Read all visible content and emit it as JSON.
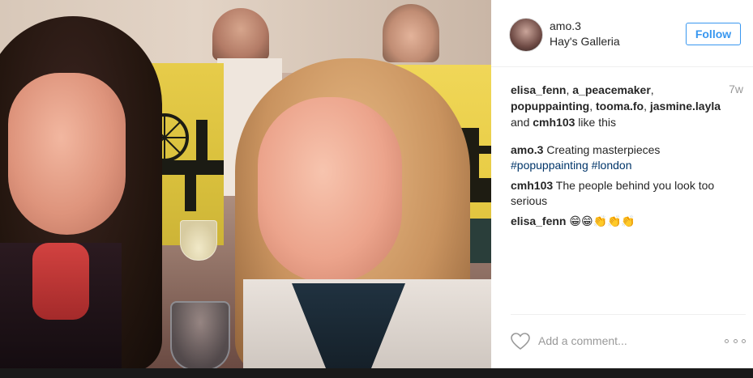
{
  "post": {
    "username": "amo.3",
    "location": "Hay's Galleria",
    "follow_label": "Follow",
    "time_ago": "7w"
  },
  "likes": {
    "users": [
      "elisa_fenn",
      "a_peacemaker",
      "popuppainting",
      "tooma.fo",
      "jasmine.layla",
      "cmh103"
    ],
    "connector": "and",
    "suffix": "like this"
  },
  "comments": [
    {
      "user": "amo.3",
      "text": "Creating masterpieces",
      "tags": [
        "#popuppainting",
        "#london"
      ]
    },
    {
      "user": "cmh103",
      "text": "The people behind you look too serious",
      "tags": []
    },
    {
      "user": "elisa_fenn",
      "text": "😁😁👏👏👏",
      "tags": []
    }
  ],
  "comment_box": {
    "placeholder": "Add a comment..."
  },
  "icons": {
    "like": "heart-icon",
    "options": "more-options-icon"
  },
  "colors": {
    "accent": "#3897f0",
    "text": "#262626",
    "muted": "#999999",
    "hashtag": "#003569"
  }
}
